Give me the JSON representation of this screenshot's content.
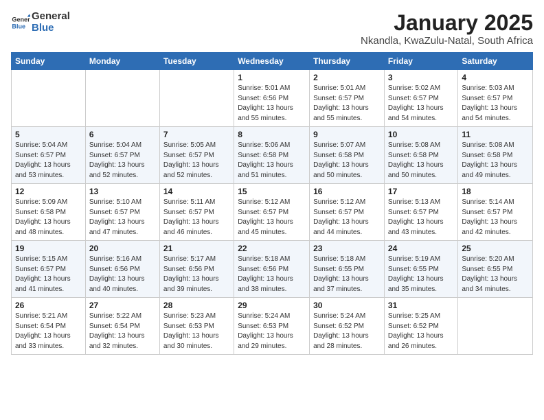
{
  "header": {
    "logo_general": "General",
    "logo_blue": "Blue",
    "title": "January 2025",
    "subtitle": "Nkandla, KwaZulu-Natal, South Africa"
  },
  "days_of_week": [
    "Sunday",
    "Monday",
    "Tuesday",
    "Wednesday",
    "Thursday",
    "Friday",
    "Saturday"
  ],
  "weeks": [
    [
      {
        "day": "",
        "info": ""
      },
      {
        "day": "",
        "info": ""
      },
      {
        "day": "",
        "info": ""
      },
      {
        "day": "1",
        "info": "Sunrise: 5:01 AM\nSunset: 6:56 PM\nDaylight: 13 hours\nand 55 minutes."
      },
      {
        "day": "2",
        "info": "Sunrise: 5:01 AM\nSunset: 6:57 PM\nDaylight: 13 hours\nand 55 minutes."
      },
      {
        "day": "3",
        "info": "Sunrise: 5:02 AM\nSunset: 6:57 PM\nDaylight: 13 hours\nand 54 minutes."
      },
      {
        "day": "4",
        "info": "Sunrise: 5:03 AM\nSunset: 6:57 PM\nDaylight: 13 hours\nand 54 minutes."
      }
    ],
    [
      {
        "day": "5",
        "info": "Sunrise: 5:04 AM\nSunset: 6:57 PM\nDaylight: 13 hours\nand 53 minutes."
      },
      {
        "day": "6",
        "info": "Sunrise: 5:04 AM\nSunset: 6:57 PM\nDaylight: 13 hours\nand 52 minutes."
      },
      {
        "day": "7",
        "info": "Sunrise: 5:05 AM\nSunset: 6:57 PM\nDaylight: 13 hours\nand 52 minutes."
      },
      {
        "day": "8",
        "info": "Sunrise: 5:06 AM\nSunset: 6:58 PM\nDaylight: 13 hours\nand 51 minutes."
      },
      {
        "day": "9",
        "info": "Sunrise: 5:07 AM\nSunset: 6:58 PM\nDaylight: 13 hours\nand 50 minutes."
      },
      {
        "day": "10",
        "info": "Sunrise: 5:08 AM\nSunset: 6:58 PM\nDaylight: 13 hours\nand 50 minutes."
      },
      {
        "day": "11",
        "info": "Sunrise: 5:08 AM\nSunset: 6:58 PM\nDaylight: 13 hours\nand 49 minutes."
      }
    ],
    [
      {
        "day": "12",
        "info": "Sunrise: 5:09 AM\nSunset: 6:58 PM\nDaylight: 13 hours\nand 48 minutes."
      },
      {
        "day": "13",
        "info": "Sunrise: 5:10 AM\nSunset: 6:57 PM\nDaylight: 13 hours\nand 47 minutes."
      },
      {
        "day": "14",
        "info": "Sunrise: 5:11 AM\nSunset: 6:57 PM\nDaylight: 13 hours\nand 46 minutes."
      },
      {
        "day": "15",
        "info": "Sunrise: 5:12 AM\nSunset: 6:57 PM\nDaylight: 13 hours\nand 45 minutes."
      },
      {
        "day": "16",
        "info": "Sunrise: 5:12 AM\nSunset: 6:57 PM\nDaylight: 13 hours\nand 44 minutes."
      },
      {
        "day": "17",
        "info": "Sunrise: 5:13 AM\nSunset: 6:57 PM\nDaylight: 13 hours\nand 43 minutes."
      },
      {
        "day": "18",
        "info": "Sunrise: 5:14 AM\nSunset: 6:57 PM\nDaylight: 13 hours\nand 42 minutes."
      }
    ],
    [
      {
        "day": "19",
        "info": "Sunrise: 5:15 AM\nSunset: 6:57 PM\nDaylight: 13 hours\nand 41 minutes."
      },
      {
        "day": "20",
        "info": "Sunrise: 5:16 AM\nSunset: 6:56 PM\nDaylight: 13 hours\nand 40 minutes."
      },
      {
        "day": "21",
        "info": "Sunrise: 5:17 AM\nSunset: 6:56 PM\nDaylight: 13 hours\nand 39 minutes."
      },
      {
        "day": "22",
        "info": "Sunrise: 5:18 AM\nSunset: 6:56 PM\nDaylight: 13 hours\nand 38 minutes."
      },
      {
        "day": "23",
        "info": "Sunrise: 5:18 AM\nSunset: 6:55 PM\nDaylight: 13 hours\nand 37 minutes."
      },
      {
        "day": "24",
        "info": "Sunrise: 5:19 AM\nSunset: 6:55 PM\nDaylight: 13 hours\nand 35 minutes."
      },
      {
        "day": "25",
        "info": "Sunrise: 5:20 AM\nSunset: 6:55 PM\nDaylight: 13 hours\nand 34 minutes."
      }
    ],
    [
      {
        "day": "26",
        "info": "Sunrise: 5:21 AM\nSunset: 6:54 PM\nDaylight: 13 hours\nand 33 minutes."
      },
      {
        "day": "27",
        "info": "Sunrise: 5:22 AM\nSunset: 6:54 PM\nDaylight: 13 hours\nand 32 minutes."
      },
      {
        "day": "28",
        "info": "Sunrise: 5:23 AM\nSunset: 6:53 PM\nDaylight: 13 hours\nand 30 minutes."
      },
      {
        "day": "29",
        "info": "Sunrise: 5:24 AM\nSunset: 6:53 PM\nDaylight: 13 hours\nand 29 minutes."
      },
      {
        "day": "30",
        "info": "Sunrise: 5:24 AM\nSunset: 6:52 PM\nDaylight: 13 hours\nand 28 minutes."
      },
      {
        "day": "31",
        "info": "Sunrise: 5:25 AM\nSunset: 6:52 PM\nDaylight: 13 hours\nand 26 minutes."
      },
      {
        "day": "",
        "info": ""
      }
    ]
  ]
}
